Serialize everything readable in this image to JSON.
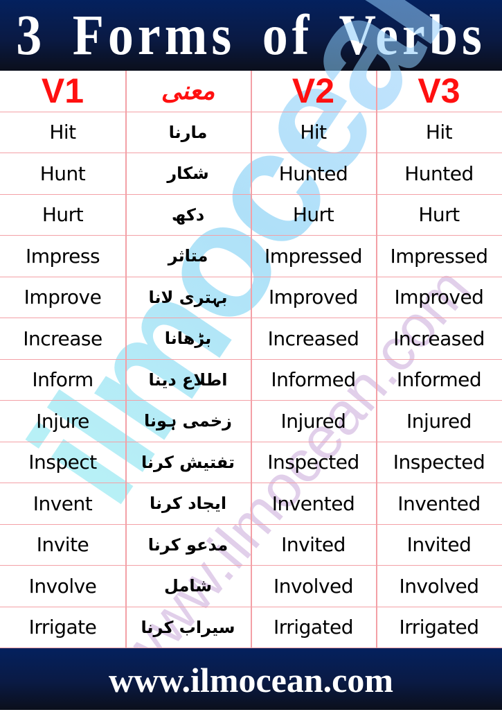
{
  "header": {
    "title": "3 Forms of Verbs"
  },
  "footer": {
    "url": "www.ilmocean.com"
  },
  "watermark": {
    "brand": "ilmocean",
    "url": "www.ilmocean.com"
  },
  "colors": {
    "banner": "#04215e",
    "heading": "#ff1010",
    "grid": "#f3a0a6"
  },
  "table": {
    "columns": [
      "V1",
      "معنی",
      "V2",
      "V3"
    ],
    "rows": [
      {
        "v1": "Hit",
        "meaning": "مارنا",
        "v2": "Hit",
        "v3": "Hit"
      },
      {
        "v1": "Hunt",
        "meaning": "شکار",
        "v2": "Hunted",
        "v3": "Hunted"
      },
      {
        "v1": "Hurt",
        "meaning": "دکھ",
        "v2": "Hurt",
        "v3": "Hurt"
      },
      {
        "v1": "Impress",
        "meaning": "متاثر",
        "v2": "Impressed",
        "v3": "Impressed"
      },
      {
        "v1": "Improve",
        "meaning": "بہتری لانا",
        "v2": "Improved",
        "v3": "Improved"
      },
      {
        "v1": "Increase",
        "meaning": "بڑھانا",
        "v2": "Increased",
        "v3": "Increased"
      },
      {
        "v1": "Inform",
        "meaning": "اطلاع دینا",
        "v2": "Informed",
        "v3": "Informed"
      },
      {
        "v1": "Injure",
        "meaning": "زخمی ہونا",
        "v2": "Injured",
        "v3": "Injured"
      },
      {
        "v1": "Inspect",
        "meaning": "تفتیش کرنا",
        "v2": "Inspected",
        "v3": "Inspected"
      },
      {
        "v1": "Invent",
        "meaning": "ایجاد کرنا",
        "v2": "Invented",
        "v3": "Invented"
      },
      {
        "v1": "Invite",
        "meaning": "مدعو کرنا",
        "v2": "Invited",
        "v3": "Invited"
      },
      {
        "v1": "Involve",
        "meaning": "شامل",
        "v2": "Involved",
        "v3": "Involved"
      },
      {
        "v1": "Irrigate",
        "meaning": "سیراب کرنا",
        "v2": "Irrigated",
        "v3": "Irrigated"
      }
    ]
  }
}
